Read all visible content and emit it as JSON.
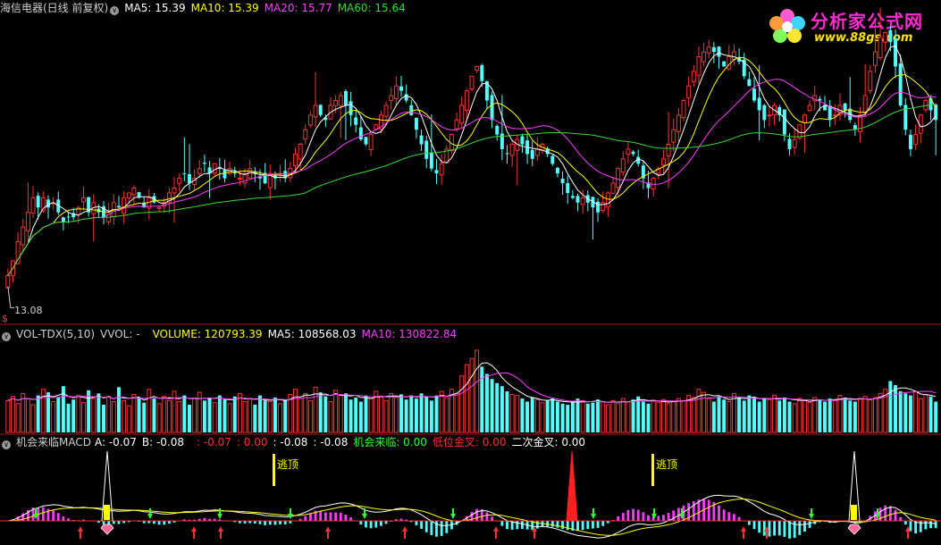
{
  "watermark": {
    "title": "分析家公式网",
    "url": "www.88gs.com",
    "icon": "flower-logo-icon"
  },
  "main_header": {
    "title": "海信电器(日线 前复权)",
    "ma5": "MA5: 15.39",
    "ma10": "MA10: 15.39",
    "ma20": "MA20: 15.77",
    "ma60": "MA60: 15.64",
    "colors": {
      "ma5": "#ffffff",
      "ma10": "#ffff00",
      "ma20": "#ff3cff",
      "ma60": "#33dd33"
    }
  },
  "low_label": "13.08",
  "low_marker": "$",
  "vol_header": {
    "title": "VOL-TDX(5,10)",
    "vvol": "VVOL: -",
    "volume": "VOLUME: 120793.39",
    "ma5": "MA5: 108568.03",
    "ma10": "MA10: 130822.84"
  },
  "macd_header": {
    "title": "机会来临MACD",
    "a": "A: -0.07",
    "b": "B: -0.08",
    "v1": ": -0.07",
    "v2": ": 0.00",
    "v3": ": -0.08",
    "v4": ": -0.08",
    "chance": "机会来临: 0.00",
    "low_cross": "低位金叉: 0.00",
    "second_cross": "二次金叉: 0.00"
  },
  "annotations": [
    {
      "text": "逃顶"
    },
    {
      "text": "逃顶"
    }
  ],
  "chart_data": [
    {
      "type": "candlestick",
      "title": "海信电器(日线 前复权)",
      "low_label": 13.08,
      "ylim": [
        12.5,
        18.6
      ],
      "colors": {
        "up": "#ff3232",
        "down": "#54ffff"
      },
      "close": [
        13.3,
        13.6,
        14.0,
        14.3,
        14.6,
        14.9,
        14.7,
        14.9,
        14.7,
        14.8,
        14.6,
        14.4,
        14.5,
        14.5,
        14.7,
        14.9,
        14.6,
        14.8,
        14.6,
        14.5,
        14.6,
        14.8,
        14.7,
        14.9,
        15.0,
        15.1,
        14.9,
        14.7,
        14.9,
        14.8,
        14.7,
        14.8,
        15.0,
        15.1,
        15.3,
        15.4,
        15.2,
        15.3,
        15.5,
        15.6,
        15.4,
        15.6,
        15.5,
        15.3,
        15.5,
        15.4,
        15.3,
        15.4,
        15.5,
        15.4,
        15.3,
        15.2,
        15.4,
        15.3,
        15.4,
        15.3,
        15.5,
        15.8,
        16.0,
        16.3,
        16.6,
        16.8,
        16.6,
        16.5,
        16.8,
        16.9,
        17.0,
        16.8,
        16.6,
        16.4,
        16.1,
        16.0,
        16.2,
        16.4,
        16.6,
        16.8,
        17.0,
        17.2,
        17.1,
        16.9,
        16.6,
        16.3,
        16.0,
        15.7,
        15.5,
        15.4,
        15.6,
        15.9,
        16.2,
        16.5,
        16.8,
        17.1,
        17.4,
        17.6,
        17.3,
        16.9,
        16.5,
        16.2,
        15.9,
        15.8,
        16.0,
        16.1,
        16.0,
        15.8,
        15.7,
        15.9,
        16.0,
        15.8,
        15.6,
        15.4,
        15.2,
        15.0,
        14.9,
        14.8,
        14.9,
        14.8,
        14.7,
        14.6,
        14.8,
        15.0,
        15.2,
        15.5,
        15.7,
        15.9,
        15.8,
        15.6,
        15.3,
        15.1,
        15.3,
        15.5,
        15.7,
        16.0,
        16.3,
        16.6,
        16.9,
        17.2,
        17.5,
        17.8,
        17.9,
        18.0,
        17.9,
        17.8,
        17.6,
        17.8,
        17.9,
        17.7,
        17.4,
        17.2,
        16.9,
        16.7,
        16.5,
        16.6,
        16.8,
        16.6,
        16.2,
        15.9,
        16.1,
        16.4,
        16.6,
        16.8,
        17.0,
        16.9,
        16.7,
        16.5,
        16.6,
        16.8,
        16.7,
        16.5,
        16.3,
        16.6,
        17.0,
        17.5,
        17.9,
        18.2,
        18.3,
        18.1,
        17.6,
        16.8,
        16.3,
        15.9,
        16.2,
        16.6,
        16.9,
        16.7,
        16.5
      ]
    },
    {
      "type": "bar",
      "title": "VOL-TDX(5,10)",
      "ylim": [
        0,
        1
      ],
      "values": [
        0.31,
        0.35,
        0.28,
        0.38,
        0.33,
        0.27,
        0.36,
        0.42,
        0.39,
        0.3,
        0.34,
        0.45,
        0.28,
        0.32,
        0.36,
        0.29,
        0.41,
        0.33,
        0.38,
        0.27,
        0.35,
        0.3,
        0.44,
        0.31,
        0.26,
        0.37,
        0.34,
        0.29,
        0.42,
        0.33,
        0.28,
        0.35,
        0.31,
        0.4,
        0.3,
        0.36,
        0.27,
        0.33,
        0.39,
        0.31,
        0.34,
        0.29,
        0.36,
        0.32,
        0.28,
        0.35,
        0.38,
        0.3,
        0.33,
        0.27,
        0.36,
        0.31,
        0.3,
        0.34,
        0.28,
        0.32,
        0.37,
        0.42,
        0.33,
        0.38,
        0.31,
        0.44,
        0.39,
        0.35,
        0.3,
        0.41,
        0.36,
        0.38,
        0.32,
        0.34,
        0.3,
        0.36,
        0.33,
        0.4,
        0.35,
        0.31,
        0.38,
        0.34,
        0.37,
        0.32,
        0.36,
        0.33,
        0.38,
        0.35,
        0.31,
        0.36,
        0.4,
        0.34,
        0.42,
        0.38,
        0.55,
        0.66,
        0.72,
        0.8,
        0.64,
        0.57,
        0.52,
        0.48,
        0.45,
        0.4,
        0.37,
        0.36,
        0.33,
        0.3,
        0.34,
        0.32,
        0.29,
        0.31,
        0.33,
        0.3,
        0.28,
        0.27,
        0.3,
        0.33,
        0.31,
        0.28,
        0.29,
        0.32,
        0.3,
        0.27,
        0.31,
        0.28,
        0.33,
        0.3,
        0.32,
        0.35,
        0.3,
        0.28,
        0.31,
        0.29,
        0.32,
        0.28,
        0.3,
        0.33,
        0.31,
        0.36,
        0.34,
        0.42,
        0.39,
        0.33,
        0.3,
        0.35,
        0.32,
        0.3,
        0.38,
        0.33,
        0.31,
        0.36,
        0.34,
        0.3,
        0.33,
        0.32,
        0.36,
        0.31,
        0.34,
        0.3,
        0.28,
        0.33,
        0.31,
        0.29,
        0.34,
        0.32,
        0.3,
        0.33,
        0.31,
        0.36,
        0.34,
        0.31,
        0.3,
        0.33,
        0.35,
        0.32,
        0.34,
        0.38,
        0.42,
        0.5,
        0.46,
        0.4,
        0.38,
        0.36,
        0.4,
        0.33,
        0.37,
        0.35,
        0.3
      ]
    }
  ]
}
